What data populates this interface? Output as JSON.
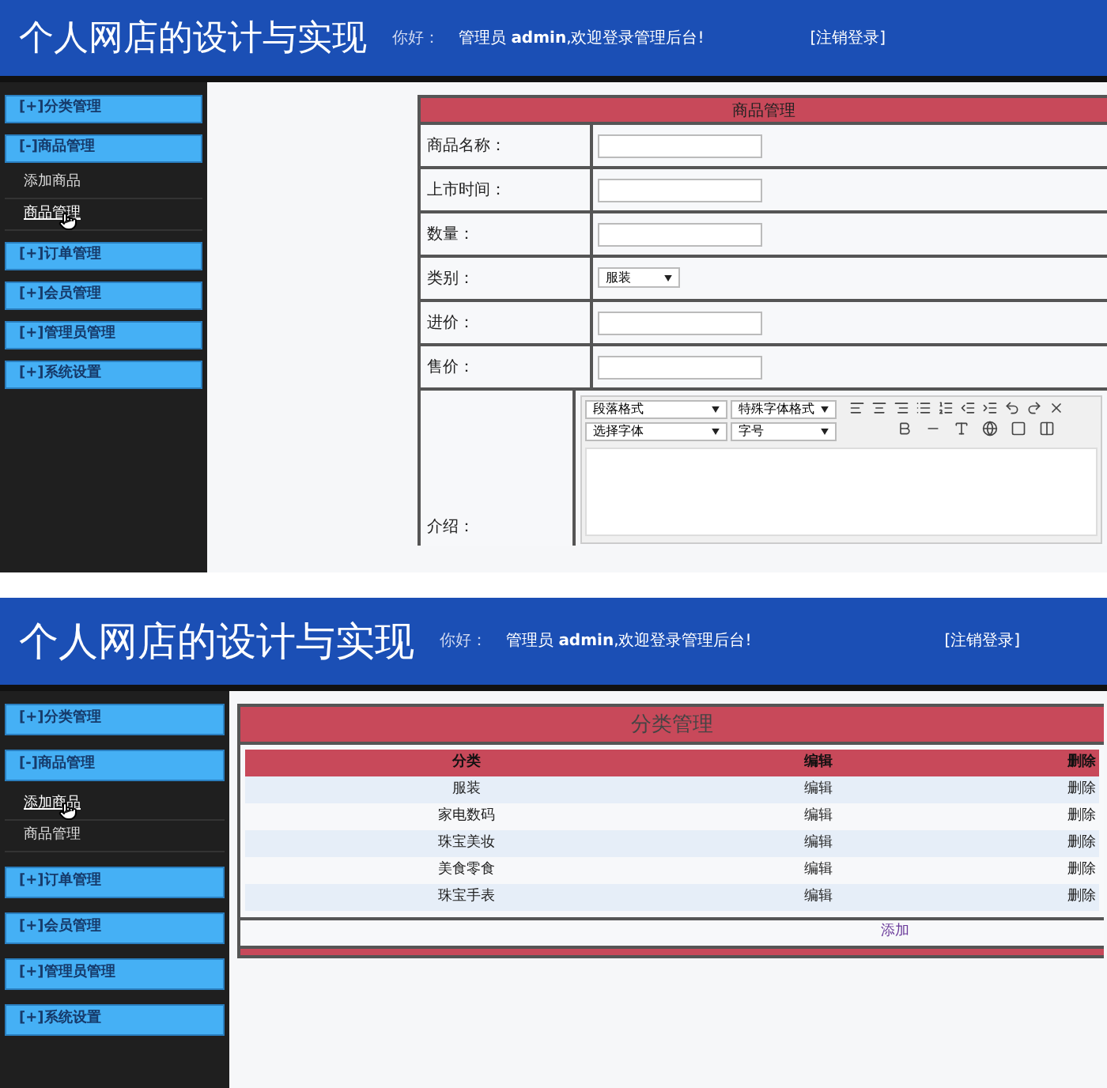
{
  "panels": [
    {
      "header": {
        "title": "个人网店的设计与实现",
        "greeting": "你好：",
        "welcome": "管理员 **admin**,欢迎登录管理后台!",
        "logout": "[注销登录]"
      },
      "sidebar": {
        "items": [
          {
            "label": "[+]分类管理"
          },
          {
            "label": "[-]商品管理",
            "children": [
              {
                "label": "添加商品",
                "hovered": false
              },
              {
                "label": "商品管理",
                "hovered": true
              }
            ]
          },
          {
            "label": "[+]订单管理"
          },
          {
            "label": "[+]会员管理"
          },
          {
            "label": "[+]管理员管理"
          },
          {
            "label": "[+]系统设置"
          }
        ]
      },
      "content": {
        "kind": "form",
        "title": "商品管理",
        "rows": [
          {
            "kind": "text",
            "label": "商品名称："
          },
          {
            "kind": "text",
            "label": "上市时间："
          },
          {
            "kind": "text",
            "label": "数量："
          },
          {
            "kind": "select",
            "label": "类别：",
            "value": "服装"
          },
          {
            "kind": "text",
            "label": "进价："
          },
          {
            "kind": "text",
            "label": "售价："
          },
          {
            "kind": "editor",
            "label": "介绍：",
            "selects": [
              "段落格式",
              "特殊字体格式",
              "选择字体",
              "字号"
            ]
          }
        ]
      }
    },
    {
      "header": {
        "title": "个人网店的设计与实现",
        "greeting": "你好：",
        "welcome": "管理员 **admin**,欢迎登录管理后台!",
        "logout": "[注销登录]"
      },
      "sidebar": {
        "items": [
          {
            "label": "[+]分类管理"
          },
          {
            "label": "[-]商品管理",
            "children": [
              {
                "label": "添加商品",
                "hovered": true
              },
              {
                "label": "商品管理",
                "hovered": false
              }
            ]
          },
          {
            "label": "[+]订单管理"
          },
          {
            "label": "[+]会员管理"
          },
          {
            "label": "[+]管理员管理"
          },
          {
            "label": "[+]系统设置"
          }
        ]
      },
      "content": {
        "kind": "table",
        "title": "分类管理",
        "columns": [
          "分类",
          "编辑",
          "删除"
        ],
        "rows": [
          [
            "服装",
            "编辑",
            "删除"
          ],
          [
            "家电数码",
            "编辑",
            "删除"
          ],
          [
            "珠宝美妆",
            "编辑",
            "删除"
          ],
          [
            "美食零食",
            "编辑",
            "删除"
          ],
          [
            "珠宝手表",
            "编辑",
            "删除"
          ]
        ],
        "add": "添加"
      }
    }
  ]
}
